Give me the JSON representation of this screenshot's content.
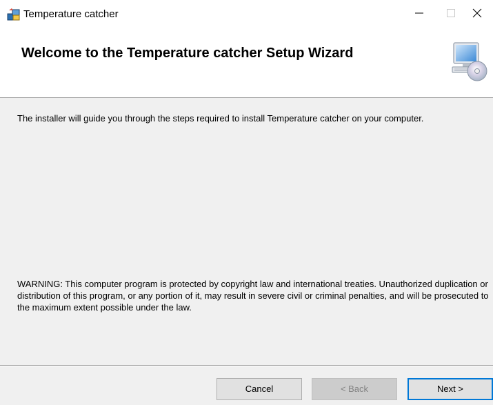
{
  "window": {
    "title": "Temperature catcher",
    "icons": {
      "app": "installer-app-icon",
      "minimize": "minimize-icon",
      "maximize": "maximize-icon",
      "close": "close-icon"
    }
  },
  "header": {
    "title": "Welcome to the Temperature catcher Setup Wizard",
    "icon": "computer-cd-icon"
  },
  "content": {
    "intro": "The installer will guide you through the steps required to install Temperature catcher on your computer.",
    "warning": "WARNING: This computer program is protected by copyright law and international treaties. Unauthorized duplication or distribution of this program, or any portion of it, may result in severe civil or criminal penalties, and will be prosecuted to the maximum extent possible under the law."
  },
  "buttons": {
    "cancel": "Cancel",
    "back": "< Back",
    "next": "Next >",
    "back_disabled": true,
    "default_accent": "#0078d7"
  }
}
